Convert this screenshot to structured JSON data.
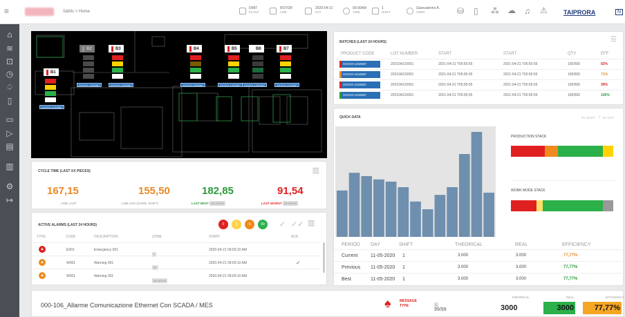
{
  "topbar": {
    "breadcrumb": "S&Ms > Home",
    "plant": {
      "value": "DMIT",
      "label": "PLANT"
    },
    "line": {
      "value": "ROTOR",
      "label": "LINE"
    },
    "day": {
      "value": "2020-04-21",
      "label": "DAY"
    },
    "time": {
      "value": "09:00AM",
      "label": "TIME"
    },
    "shift": {
      "value": "1",
      "label": "SHIFT"
    },
    "user": {
      "value": "Giancaterino A.",
      "label": "USER"
    },
    "brand": "TAIPRORA",
    "brand_tail": "N"
  },
  "layout": {
    "labels": [
      "B1",
      "B2",
      "B3",
      "B4",
      "B5",
      "B6",
      "B7"
    ],
    "codes": [
      "XXXXX-1234567",
      "XXXXX-1234567",
      "XXXXX-1234567",
      "XXXXX-1234567",
      "XXXXX-1234567",
      "XXXXX-1234567",
      "XXXXX-1234567",
      "XXXXX-1234567"
    ]
  },
  "batches": {
    "title": "BATCHES (LAST 24 HOURS)",
    "headers": [
      "PRODUCT CODE",
      "LOT NUMBER",
      "START",
      "START",
      "QTY",
      "EFF"
    ],
    "rows": [
      {
        "code": "XXXXX-1234567",
        "lot": "202104210001",
        "start1": "2021-04-21 T05:55:55",
        "start2": "2021-04-21 T05:55:55",
        "qty": "100/500",
        "eff": "92%",
        "color": "#e02020"
      },
      {
        "code": "XXXXX-1234567",
        "lot": "202104210001",
        "start1": "2021-04-21 T05:55:55",
        "start2": "2021-04-21 T05:55:55",
        "qty": "100/500",
        "eff": "71%",
        "color": "#e8892a"
      },
      {
        "code": "XXXXX-1234567",
        "lot": "202104210001",
        "start1": "2021-04-21 T05:55:55",
        "start2": "2021-04-21 T05:55:55",
        "qty": "100/500",
        "eff": "39%",
        "color": "#e02020"
      },
      {
        "code": "XXXXX-1234567",
        "lot": "202104210001",
        "start1": "2021-04-21 T05:55:55",
        "start2": "2021-04-21 T05:55:55",
        "qty": "100/500",
        "eff": "100%",
        "color": "#2a9a3a"
      }
    ]
  },
  "quick": {
    "title": "QUICK DATA",
    "toggle_a": "BY SHIFT",
    "toggle_b": "BY DAY",
    "production_stack": "PRODUCTION STACK",
    "work_mode_stack": "WORK MODE STACK",
    "bars": [
      0.42,
      0.58,
      0.55,
      0.52,
      0.5,
      0.45,
      0.32,
      0.25,
      0.38,
      0.45,
      0.75,
      0.95,
      0.4
    ],
    "prod_segments": [
      {
        "w": 0.33,
        "c": "#e02020"
      },
      {
        "w": 0.13,
        "c": "#f08a1e"
      },
      {
        "w": 0.44,
        "c": "#2bb04a"
      },
      {
        "w": 0.1,
        "c": "#ffd200"
      }
    ],
    "work_segments": [
      {
        "w": 0.25,
        "c": "#e02020"
      },
      {
        "w": 0.06,
        "c": "#ffe066"
      },
      {
        "w": 0.59,
        "c": "#2bb04a"
      },
      {
        "w": 0.1,
        "c": "#999999"
      }
    ],
    "headers": [
      "PERIOD",
      "DAY",
      "SHIFT",
      "THEORICAL",
      "REAL",
      "EFFICIENCY"
    ],
    "rows": [
      {
        "period": "Current",
        "day": "11-05-2020",
        "shift": "1",
        "theo": "3.000",
        "real": "3.000",
        "eff": "77,77%",
        "effcolor": "#e8892a"
      },
      {
        "period": "Previous",
        "day": "11-05-2020",
        "shift": "1",
        "theo": "3.000",
        "real": "3.000",
        "eff": "77,77%",
        "effcolor": "#2a9a3a"
      },
      {
        "period": "Best",
        "day": "11-05-2020",
        "shift": "1",
        "theo": "3.000",
        "real": "3.000",
        "eff": "77,77%",
        "effcolor": "#2a9a3a"
      }
    ]
  },
  "cycle": {
    "title": "CYCLE TIME (LAST XX PIECES)",
    "line_last": "167,15",
    "line_last_label": "LINE LAST",
    "line_avg": "155,50",
    "line_avg_label": "LINE AVG (CURR. SHIFT)",
    "last_best": "182,85",
    "last_best_label": "LAST BEST",
    "last_best_tag": "B2.OP100",
    "last_worst": "91,54",
    "last_worst_label": "LAST WORST",
    "last_worst_tag": "B2.OP100"
  },
  "alarms": {
    "title": "ACTIVE ALARMS (LAST 24 HOURS)",
    "counts": [
      "0",
      "2",
      "4",
      "99"
    ],
    "headers": [
      "TYPE",
      "CODE",
      "DESCRIPTION",
      "ZONE",
      "START",
      "ACK"
    ],
    "rows": [
      {
        "color": "#e02020",
        "code": "E001",
        "desc": "Emergency 001",
        "zone": "L",
        "start": "2020-04-21 09:00:10 AM",
        "ack": ""
      },
      {
        "color": "#f08a1e",
        "code": "W001",
        "desc": "Warning 001",
        "zone": "B1",
        "start": "2020-04-21 09:00:10 AM",
        "ack": "✓"
      },
      {
        "color": "#f08a1e",
        "code": "W001",
        "desc": "Warning 001",
        "zone": "B2.OP100",
        "start": "2020-04-21 09:00:10 AM",
        "ack": ""
      }
    ]
  },
  "footer": {
    "message": "000-106_Allarme Comunicazione Ethernet Con SCADA / MES",
    "msg_type_a": "MESSAGE",
    "msg_type_b": "TYPE",
    "zone": "L",
    "count": "99/99",
    "theorical_label": "THEORICAL",
    "theorical": "3000",
    "real_label": "REAL",
    "real": "3000",
    "eff_label": "EFFICIENCY",
    "eff": "77,77%"
  }
}
